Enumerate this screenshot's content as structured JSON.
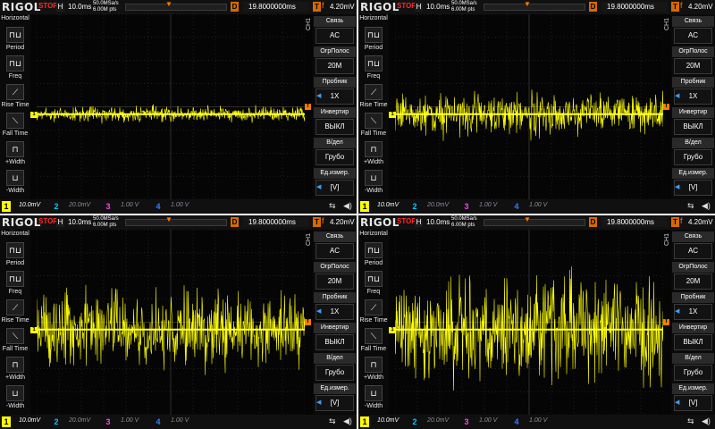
{
  "screens": [
    {
      "amplitude": 0.12
    },
    {
      "amplitude": 0.32
    },
    {
      "amplitude": 0.58
    },
    {
      "amplitude": 0.82
    }
  ],
  "header": {
    "logo": "RIGOL",
    "status": "STOP",
    "h_label": "H",
    "timebase": "10.0ms",
    "sample_rate": "50.0MSa/s",
    "memory_depth": "6.00M pts",
    "d_label": "D",
    "delay": "19.8000000ms",
    "t_label": "T",
    "trigger_icon": "f",
    "trigger_level": "4.20mV"
  },
  "left_menu": {
    "title": "Horizontal",
    "items": [
      {
        "label": "Period",
        "icon": "period-icon"
      },
      {
        "label": "Freq",
        "icon": "freq-icon"
      },
      {
        "label": "Rise Time",
        "icon": "rise-time-icon"
      },
      {
        "label": "Fall Time",
        "icon": "fall-time-icon"
      },
      {
        "label": "+Width",
        "icon": "positive-width-icon"
      },
      {
        "label": "-Width",
        "icon": "negative-width-icon"
      }
    ]
  },
  "right_menu": {
    "channel_label": "CH1",
    "items": [
      {
        "title": "Связь",
        "value": "AC",
        "arrow": ""
      },
      {
        "title": "ОгрПолос",
        "value": "20M",
        "arrow": ""
      },
      {
        "title": "Пробник",
        "value": "1X",
        "arrow": "◀"
      },
      {
        "title": "Инвертир",
        "value": "ВЫКЛ",
        "arrow": ""
      },
      {
        "title": "В/дел",
        "value": "Грубо",
        "arrow": ""
      },
      {
        "title": "Ед.измер.",
        "value": "[V]",
        "arrow": "◀"
      }
    ]
  },
  "bottom": {
    "channels": [
      {
        "num": "1",
        "value": "10.0mV",
        "color": "#ffff00"
      },
      {
        "num": "2",
        "value": "20.0mV",
        "color": "#00c8ff"
      },
      {
        "num": "3",
        "value": "1.00 V",
        "color": "#ff40ff"
      },
      {
        "num": "4",
        "value": "1.00 V",
        "color": "#3a7bff"
      }
    ],
    "ch1_marker": "1",
    "trigger_marker": "T",
    "usb_icon": "usb-icon",
    "speaker_icon": "speaker-icon"
  },
  "colors": {
    "ch1": "#ffff00",
    "trigger": "#ff7a00",
    "stop": "#ff2a2a",
    "grid": "#3c3c3c"
  }
}
